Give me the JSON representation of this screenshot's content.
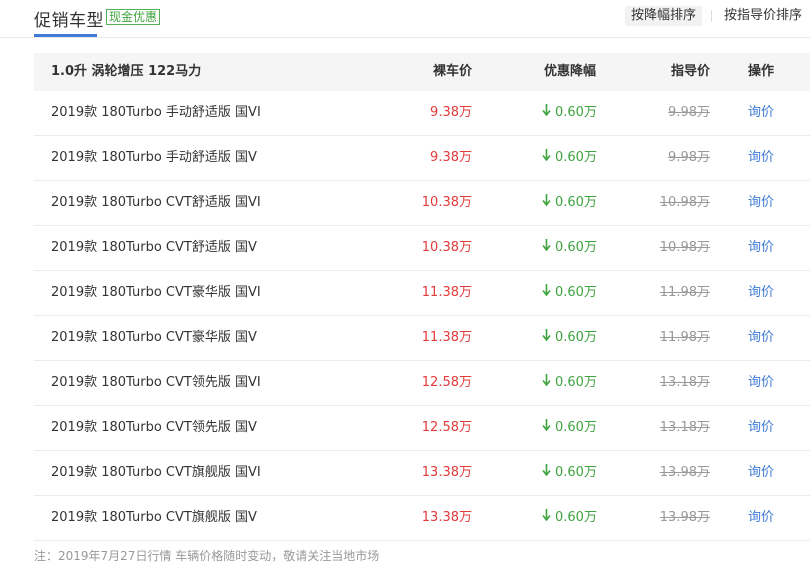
{
  "header": {
    "title": "促销车型",
    "promo_tag": "现金优惠",
    "sort_discount": "按降幅排序",
    "sort_guide": "按指导价排序"
  },
  "table": {
    "columns": {
      "name": "1.0升 涡轮增压 122马力",
      "price": "裸车价",
      "discount": "优惠降幅",
      "guide": "指导价",
      "action": "操作"
    },
    "rows": [
      {
        "name": "2019款 180Turbo 手动舒适版 国VI",
        "price": "9.38万",
        "discount": "0.60万",
        "guide": "9.98万",
        "action": "询价"
      },
      {
        "name": "2019款 180Turbo 手动舒适版 国V",
        "price": "9.38万",
        "discount": "0.60万",
        "guide": "9.98万",
        "action": "询价"
      },
      {
        "name": "2019款 180Turbo CVT舒适版 国VI",
        "price": "10.38万",
        "discount": "0.60万",
        "guide": "10.98万",
        "action": "询价"
      },
      {
        "name": "2019款 180Turbo CVT舒适版 国V",
        "price": "10.38万",
        "discount": "0.60万",
        "guide": "10.98万",
        "action": "询价"
      },
      {
        "name": "2019款 180Turbo CVT豪华版 国VI",
        "price": "11.38万",
        "discount": "0.60万",
        "guide": "11.98万",
        "action": "询价"
      },
      {
        "name": "2019款 180Turbo CVT豪华版 国V",
        "price": "11.38万",
        "discount": "0.60万",
        "guide": "11.98万",
        "action": "询价"
      },
      {
        "name": "2019款 180Turbo CVT领先版 国VI",
        "price": "12.58万",
        "discount": "0.60万",
        "guide": "13.18万",
        "action": "询价"
      },
      {
        "name": "2019款 180Turbo CVT领先版 国V",
        "price": "12.58万",
        "discount": "0.60万",
        "guide": "13.18万",
        "action": "询价"
      },
      {
        "name": "2019款 180Turbo CVT旗舰版 国VI",
        "price": "13.38万",
        "discount": "0.60万",
        "guide": "13.98万",
        "action": "询价"
      },
      {
        "name": "2019款 180Turbo CVT旗舰版 国V",
        "price": "13.38万",
        "discount": "0.60万",
        "guide": "13.98万",
        "action": "询价"
      }
    ]
  },
  "note": "注：2019年7月27日行情 车辆价格随时变动，敬请关注当地市场",
  "icons": {
    "discount_arrow": "down-arrow-icon"
  },
  "colors": {
    "accent": "#3f7bd6",
    "price": "#e33a3a",
    "discount": "#3fa33f",
    "muted": "#999999"
  }
}
